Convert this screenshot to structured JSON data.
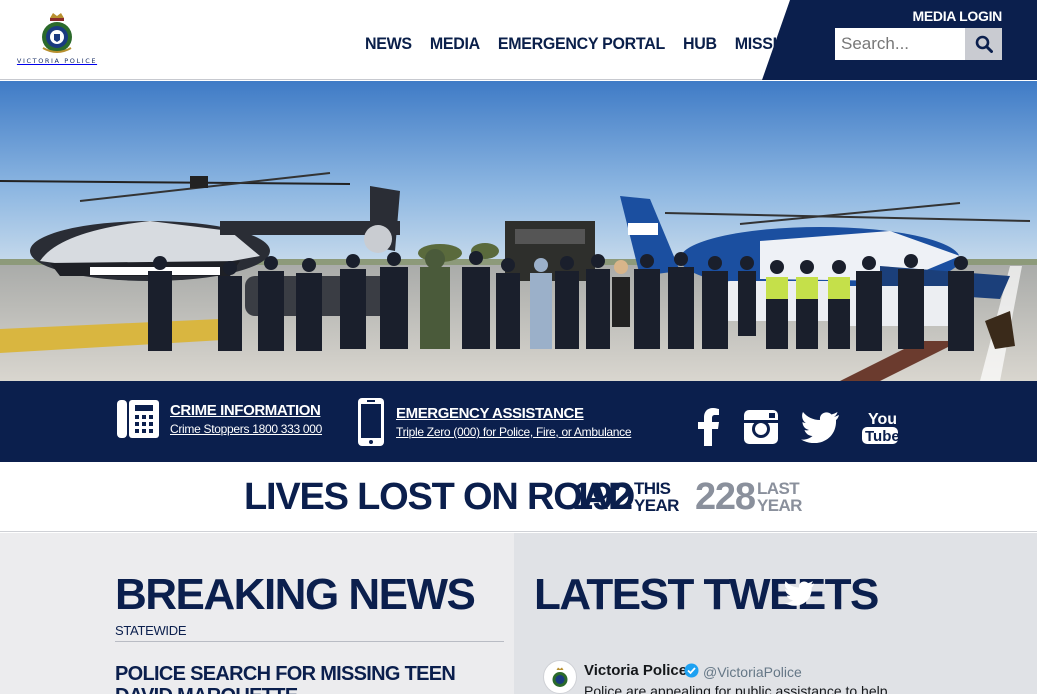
{
  "header": {
    "logo_text": "VICTORIA POLICE",
    "nav": [
      "NEWS",
      "MEDIA",
      "EMERGENCY PORTAL",
      "HUB",
      "MISSING"
    ],
    "media_login": "MEDIA LOGIN",
    "search_placeholder": "Search...",
    "search_icon": "magnifier-icon"
  },
  "hero": {
    "image": "police-officers-helicopters-vehicles-photo"
  },
  "info_band": {
    "crime": {
      "icon": "phone-icon",
      "title": "CRIME INFORMATION",
      "subtitle": "Crime Stoppers 1800 333 000"
    },
    "emergency": {
      "icon": "mobile-icon",
      "title": "EMERGENCY ASSISTANCE",
      "subtitle": "Triple Zero (000) for Police, Fire, or Ambulance"
    },
    "social": [
      "facebook-icon",
      "instagram-icon",
      "twitter-icon",
      "youtube-icon"
    ],
    "youtube_label_1": "You",
    "youtube_label_2": "Tube"
  },
  "road_toll": {
    "title": "LIVES LOST ON ROAD",
    "this_year_value": "192",
    "this_year_label_1": "THIS",
    "this_year_label_2": "YEAR",
    "last_year_value": "228",
    "last_year_label_1": "LAST",
    "last_year_label_2": "YEAR"
  },
  "breaking_news": {
    "heading": "BREAKING NEWS",
    "tag": "STATEWIDE",
    "headline": "POLICE SEARCH FOR MISSING TEEN DAVID MARQUETTE"
  },
  "tweets": {
    "heading": "LATEST TWEETS",
    "author": "Victoria Police",
    "handle": "@VictoriaPolice",
    "text": "Police are appealing for public assistance to help"
  },
  "colors": {
    "navy": "#0b1f4d",
    "grey_num": "#8a909c",
    "light_bg": "#ececee"
  }
}
